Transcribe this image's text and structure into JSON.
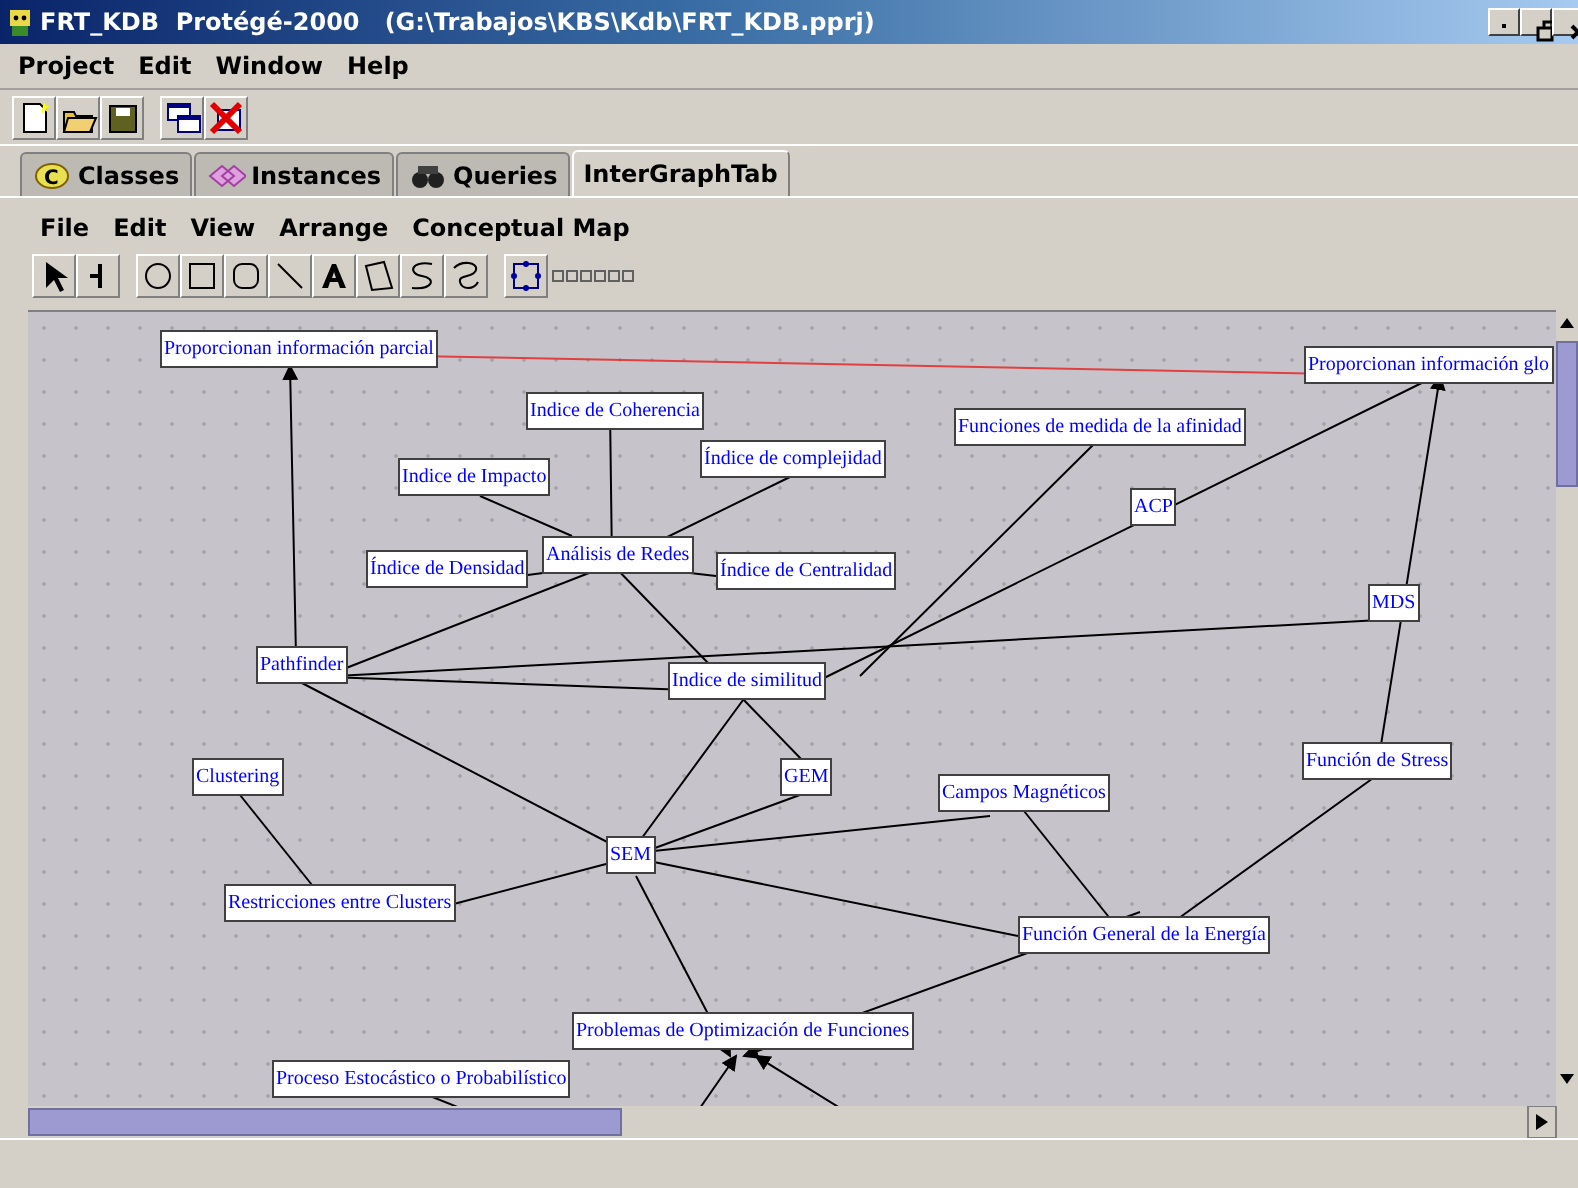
{
  "window": {
    "title": "FRT_KDB  Protégé-2000   (G:\\Trabajos\\KBS\\Kdb\\FRT_KDB.pprj)"
  },
  "menu": [
    "Project",
    "Edit",
    "Window",
    "Help"
  ],
  "tabs": [
    {
      "label": "Classes",
      "selected": false,
      "kind": "classes",
      "icon_text": "C"
    },
    {
      "label": "Instances",
      "selected": false,
      "kind": "instances"
    },
    {
      "label": "Queries",
      "selected": false,
      "kind": "queries"
    },
    {
      "label": "InterGraphTab",
      "selected": true,
      "kind": "plain"
    }
  ],
  "graph_menu": [
    "File",
    "Edit",
    "View",
    "Arrange",
    "Conceptual Map"
  ],
  "nodes": [
    {
      "label": "Proporcionan información parcial"
    },
    {
      "label": "Proporcionan información glo"
    },
    {
      "label": "Indice de Coherencia"
    },
    {
      "label": "Indice de Impacto"
    },
    {
      "label": "Índice de complejidad"
    },
    {
      "label": "Análisis de Redes"
    },
    {
      "label": "Índice de Densidad"
    },
    {
      "label": "Índice de Centralidad"
    },
    {
      "label": "Funciones de medida de la afinidad"
    },
    {
      "label": "ACP"
    },
    {
      "label": "MDS"
    },
    {
      "label": "Pathfinder"
    },
    {
      "label": "Indice de similitud"
    },
    {
      "label": "Clustering"
    },
    {
      "label": "GEM"
    },
    {
      "label": "Campos Magnéticos"
    },
    {
      "label": "Función de Stress"
    },
    {
      "label": "SEM"
    },
    {
      "label": "Restricciones entre Clusters"
    },
    {
      "label": "Función General de la Energía"
    },
    {
      "label": "Problemas de Optimización de Funciones"
    },
    {
      "label": "Proceso Estocástico o Probabilístico"
    }
  ]
}
